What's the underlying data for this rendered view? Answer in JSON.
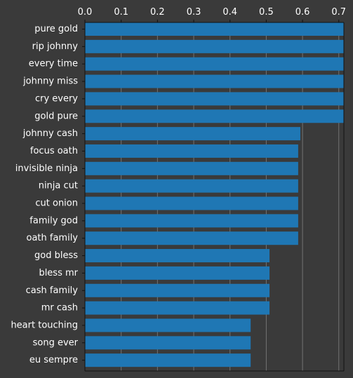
{
  "colors": {
    "background": "#3a3a3a",
    "bar": "#1f77b4",
    "axis": "#111111",
    "grid": "#8c8c8c",
    "text": "#ffffff"
  },
  "chart_data": {
    "type": "bar",
    "orientation": "horizontal",
    "categories": [
      "pure gold",
      "rip johnny",
      "every time",
      "johnny miss",
      "cry every",
      "gold pure",
      "johnny cash",
      "focus oath",
      "invisible ninja",
      "ninja cut",
      "cut onion",
      "family god",
      "oath family",
      "god bless",
      "bless mr",
      "cash family",
      "mr cash",
      "heart touching",
      "song ever",
      "eu sempre"
    ],
    "values": [
      0.714,
      0.714,
      0.714,
      0.714,
      0.714,
      0.714,
      0.594,
      0.588,
      0.588,
      0.588,
      0.588,
      0.588,
      0.588,
      0.509,
      0.509,
      0.509,
      0.509,
      0.457,
      0.457,
      0.457
    ],
    "xticks": [
      "0.0",
      "0.1",
      "0.2",
      "0.3",
      "0.4",
      "0.5",
      "0.6",
      "0.7"
    ],
    "xlim": [
      0,
      0.714
    ],
    "x_axis_position": "top",
    "grid": "vertical",
    "title": "",
    "xlabel": "",
    "ylabel": ""
  }
}
